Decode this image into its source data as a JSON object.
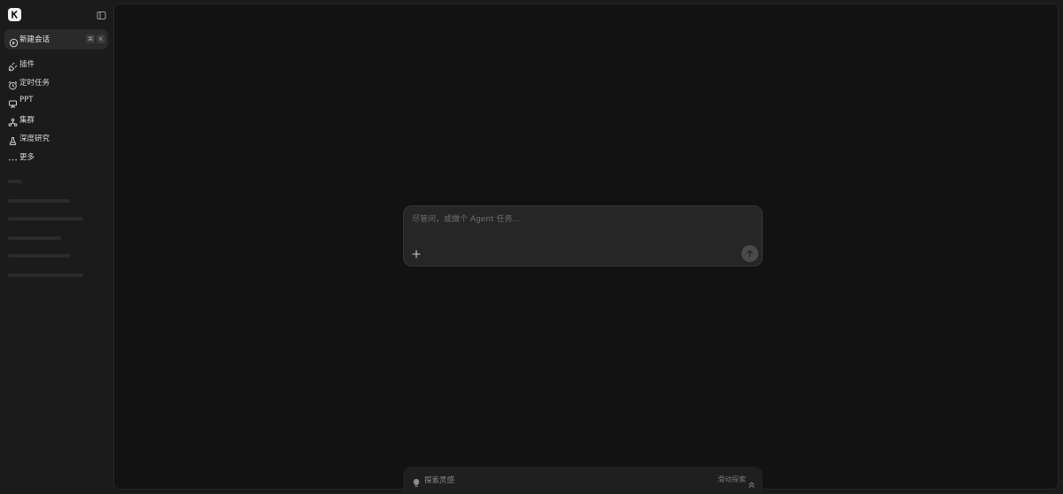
{
  "sidebar": {
    "new_chat": {
      "label": "新建会话",
      "shortcut_keys": [
        "⌘",
        "K"
      ]
    },
    "items": [
      {
        "name": "plugins",
        "label": "插件",
        "icon": "plug-icon"
      },
      {
        "name": "scheduled-tasks",
        "label": "定时任务",
        "icon": "alarm-clock-icon"
      },
      {
        "name": "ppt",
        "label": "PPT",
        "icon": "presentation-icon"
      },
      {
        "name": "cluster",
        "label": "集群",
        "icon": "cluster-icon"
      },
      {
        "name": "deep-research",
        "label": "深度研究",
        "icon": "research-flask-icon"
      },
      {
        "name": "more",
        "label": "更多",
        "icon": "more-dots-icon"
      }
    ]
  },
  "chat": {
    "placeholder": "尽管问，或做个 Agent 任务...",
    "value": ""
  },
  "explore": {
    "label": "探索灵感",
    "scroll_hint": "滑动探索"
  },
  "colors": {
    "sidebar_bg": "#1b1b1b",
    "main_bg": "#121212",
    "input_bg": "#262626",
    "logo_bg": "#f2f2f2"
  }
}
